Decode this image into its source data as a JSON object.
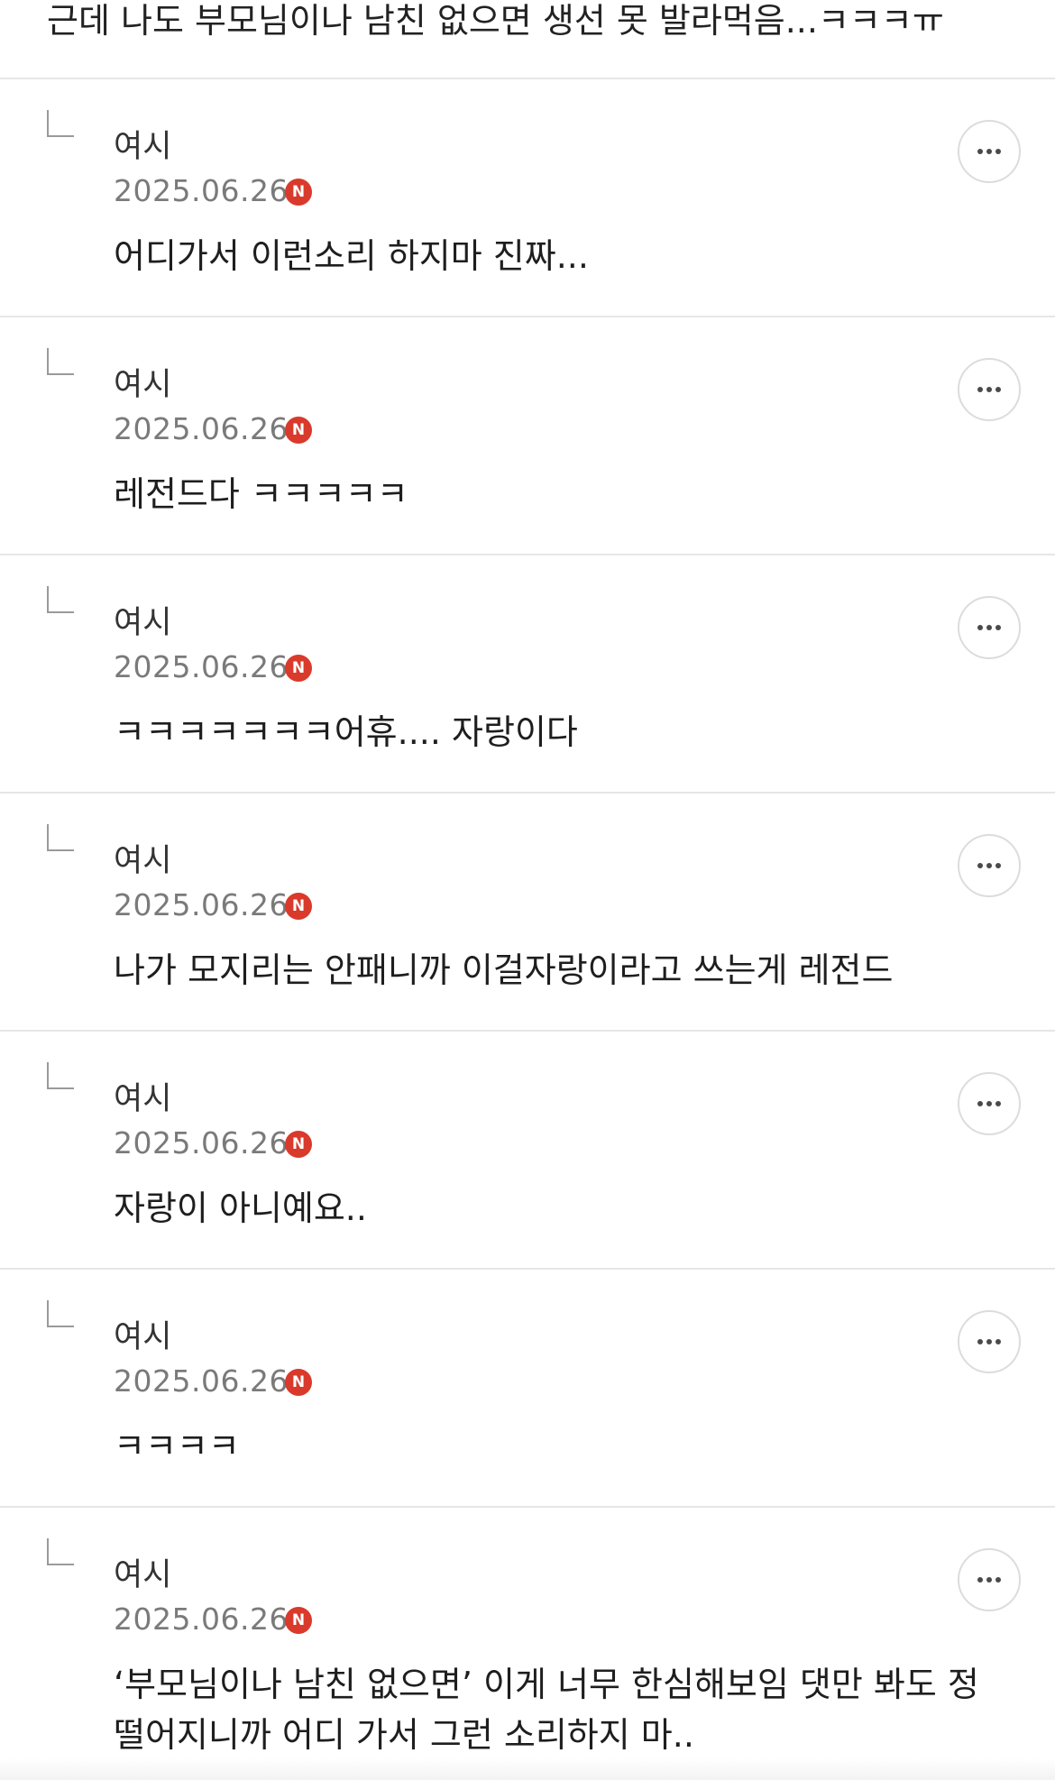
{
  "parent_comment": {
    "text": "근데 나도 부모님이나 남친 없으면 생선 못 발라먹음...ㅋㅋㅋㅠ"
  },
  "badge_letter": "N",
  "badge_color": "#d93a2b",
  "icons": {
    "reply": "reply-corner-icon",
    "more": "more-dots-icon"
  },
  "replies": [
    {
      "author": "여시",
      "date": "2025.06.26",
      "text": "어디가서 이런소리 하지마 진짜..."
    },
    {
      "author": "여시",
      "date": "2025.06.26",
      "text": "레전드다 ㅋㅋㅋㅋㅋ"
    },
    {
      "author": "여시",
      "date": "2025.06.26",
      "text": "ㅋㅋㅋㅋㅋㅋㅋ어휴.... 자랑이다"
    },
    {
      "author": "여시",
      "date": "2025.06.26",
      "text": "나가 모지리는 안패니까 이걸자랑이라고 쓰는게 레전드"
    },
    {
      "author": "여시",
      "date": "2025.06.26",
      "text": "자랑이 아니예요.."
    },
    {
      "author": "여시",
      "date": "2025.06.26",
      "text": "ㅋㅋㅋㅋ"
    },
    {
      "author": "여시",
      "date": "2025.06.26",
      "text": "‘부모님이나 남친 없으면’ 이게 너무 한심해보임 댓만 봐도 정 떨어지니까 어디 가서 그런 소리하지 마.."
    }
  ]
}
